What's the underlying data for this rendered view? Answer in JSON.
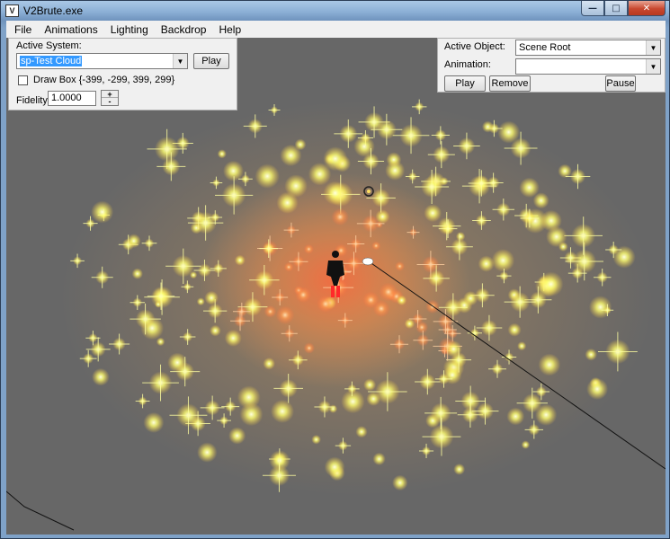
{
  "window": {
    "title": "V2Brute.exe",
    "icon_text": "V"
  },
  "caption": {
    "minimize": "—",
    "maximize": "□",
    "close": "✕"
  },
  "menu": [
    "File",
    "Animations",
    "Lighting",
    "Backdrop",
    "Help"
  ],
  "system_panel": {
    "active_system_label": "Active System:",
    "active_system_value": "sp-Test Cloud",
    "play_label": "Play",
    "draw_box_label": "Draw Box {-399, -299, 399, 299}",
    "draw_box_checked": false,
    "fidelity_label": "Fidelity",
    "fidelity_value": "1.0000",
    "spin_up": "+",
    "spin_down": "-"
  },
  "object_panel": {
    "active_object_label": "Active Object:",
    "active_object_value": "Scene Root",
    "animation_label": "Animation:",
    "animation_value": "",
    "play_label": "Play",
    "remove_label": "Remove",
    "pause_label": "Pause"
  },
  "scene": {
    "background_color": "#676767",
    "particle_color_outer": "#ffff66",
    "particle_color_inner": "#ff7040",
    "figure_color": "#111111",
    "figure_feet_color": "#ff2a2a"
  }
}
